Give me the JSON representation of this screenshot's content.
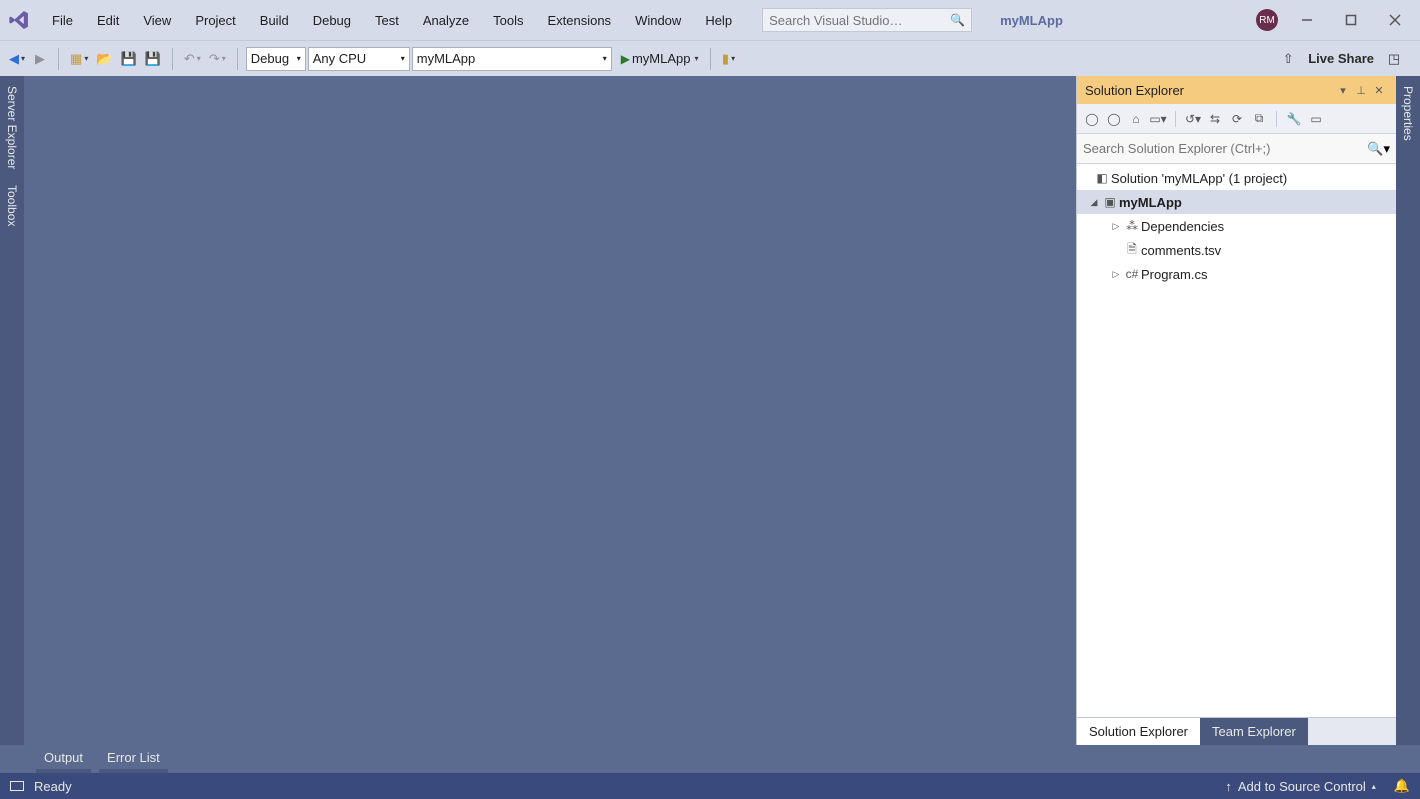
{
  "menu": {
    "items": [
      "File",
      "Edit",
      "View",
      "Project",
      "Build",
      "Debug",
      "Test",
      "Analyze",
      "Tools",
      "Extensions",
      "Window",
      "Help"
    ]
  },
  "search": {
    "placeholder": "Search Visual Studio…"
  },
  "app_title": "myMLApp",
  "avatar_initials": "RM",
  "toolbar": {
    "config": "Debug",
    "platform": "Any CPU",
    "startup_project": "myMLApp",
    "run_label": "myMLApp",
    "live_share": "Live Share"
  },
  "left_rail": {
    "items": [
      "Server Explorer",
      "Toolbox"
    ]
  },
  "right_rail": {
    "items": [
      "Properties"
    ]
  },
  "solution_explorer": {
    "title": "Solution Explorer",
    "search_placeholder": "Search Solution Explorer (Ctrl+;)",
    "root": "Solution 'myMLApp' (1 project)",
    "project": "myMLApp",
    "children": [
      {
        "label": "Dependencies",
        "expandable": true
      },
      {
        "label": "comments.tsv",
        "expandable": false
      },
      {
        "label": "Program.cs",
        "expandable": true
      }
    ],
    "tabs": [
      "Solution Explorer",
      "Team Explorer"
    ]
  },
  "bottom_tabs": [
    "Output",
    "Error List"
  ],
  "statusbar": {
    "status": "Ready",
    "source_control": "Add to Source Control"
  }
}
